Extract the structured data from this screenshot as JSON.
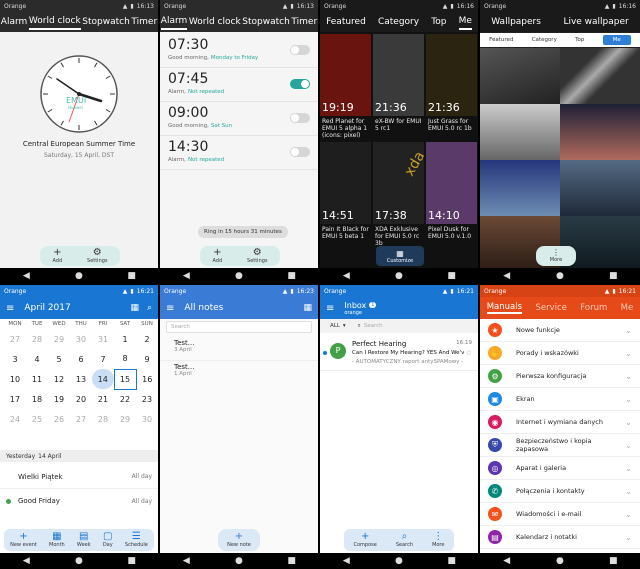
{
  "clock": {
    "status_carrier": "Orange",
    "status_time": "16:13",
    "tabs": [
      "Alarm",
      "World clock",
      "Stopwatch",
      "Timer"
    ],
    "clock_brand": "EMUI",
    "clock_sub": "Huawei",
    "zone_title": "Central European Summer Time",
    "zone_date": "Saturday, 15 April, DST",
    "add_label": "Add",
    "settings_label": "Settings"
  },
  "alarm": {
    "status_carrier": "Orange",
    "status_time": "16:13",
    "tabs": [
      "Alarm",
      "World clock",
      "Stopwatch",
      "Timer"
    ],
    "alarms": [
      {
        "time": "07:30",
        "label": "Good morning,",
        "repeat": "Monday to Friday",
        "on": false
      },
      {
        "time": "07:45",
        "label": "Alarm,",
        "repeat": "Not repeated",
        "on": true
      },
      {
        "time": "09:00",
        "label": "Good morning,",
        "repeat": "Sat Sun",
        "on": false
      },
      {
        "time": "14:30",
        "label": "Alarm,",
        "repeat": "Not repeated",
        "on": false
      }
    ],
    "ring_text": "Ring in 15 hours 31 minutes",
    "add_label": "Add",
    "settings_label": "Settings"
  },
  "themes": {
    "status_carrier": "Orange",
    "status_time": "16:16",
    "tabs": [
      "Featured",
      "Category",
      "Top",
      "Me"
    ],
    "items": [
      {
        "time": "19:19",
        "caption": "Red Planet for EMUI 5 alpha 1 (icons: pixel)",
        "color": "#6a1410"
      },
      {
        "time": "21:36",
        "caption": "eX-BW for EMUI 5 rc1",
        "color": "#3a3a3a"
      },
      {
        "time": "21:36",
        "caption": "Just Grass for EMUI 5.0 rc 1b",
        "color": "#2a2410"
      },
      {
        "time": "14:51",
        "caption": "Pain It Black for EMUI 5 beta 1",
        "color": "#1e1e1e"
      },
      {
        "time": "17:38",
        "caption": "XDA Exklusive for EMUI 5.0 rc 3b",
        "color": "#222222"
      },
      {
        "time": "14:10",
        "caption": "Pixel Dusk for EMUI 5.0 v.1.0",
        "color": "#5a3a68"
      }
    ],
    "customize_label": "Customize",
    "xda_text": "xda"
  },
  "wallpapers": {
    "status_carrier": "Orange",
    "status_time": "16:16",
    "tabs": [
      "Wallpapers",
      "Live wallpaper"
    ],
    "subtabs": [
      "Featured",
      "Category",
      "Top",
      "Me"
    ],
    "more_label": "More"
  },
  "calendar": {
    "status_carrier": "Orange",
    "status_time": "16:21",
    "month": "April 2017",
    "days": [
      "MON",
      "TUE",
      "WED",
      "THU",
      "FRI",
      "SAT",
      "SUN"
    ],
    "weeks": [
      [
        "27",
        "28",
        "29",
        "30",
        "31",
        "1",
        "2"
      ],
      [
        "3",
        "4",
        "5",
        "6",
        "7",
        "8",
        "9"
      ],
      [
        "10",
        "11",
        "12",
        "13",
        "14",
        "15",
        "16"
      ],
      [
        "17",
        "18",
        "19",
        "20",
        "21",
        "22",
        "23"
      ],
      [
        "24",
        "25",
        "26",
        "27",
        "28",
        "29",
        "30"
      ]
    ],
    "day_header": "Yesterday",
    "day_date": "14 April",
    "events": [
      {
        "title": "Wielki Piątek",
        "when": "All day"
      },
      {
        "title": "Good Friday",
        "when": "All day"
      }
    ],
    "bottom": [
      "New event",
      "Month",
      "Week",
      "Day",
      "Schedule"
    ]
  },
  "notes": {
    "status_carrier": "Orange",
    "status_time": "16:23",
    "title": "All notes",
    "search_placeholder": "Search",
    "notes": [
      {
        "title": "Test...",
        "date": "3 April"
      },
      {
        "title": "Test...",
        "date": "1 April"
      }
    ],
    "new_label": "New note"
  },
  "email": {
    "status_carrier": "Orange",
    "status_time": "16:21",
    "title": "Inbox",
    "badge": "1",
    "account": "orange",
    "filter": "ALL",
    "search_placeholder": "Search",
    "message": {
      "avatar": "P",
      "sender": "Perfect Hearing",
      "time": "16:19",
      "subject": "Can I Restore My Hearing? YES And We've...",
      "preview": "- AUTOMATYCZNY raport antySPAMowy -..."
    },
    "bottom": [
      "Compose",
      "Search",
      "More"
    ]
  },
  "manuals": {
    "status_carrier": "Orange",
    "status_time": "16:21",
    "tabs": [
      "Manuals",
      "Service",
      "Forum",
      "Me"
    ],
    "items": [
      {
        "label": "Nowe funkcje",
        "color": "#f4511e",
        "icon": "★"
      },
      {
        "label": "Porady i wskazówki",
        "color": "#f9a825",
        "icon": "✋"
      },
      {
        "label": "Pierwsza konfiguracja",
        "color": "#43a047",
        "icon": "⚙"
      },
      {
        "label": "Ekran",
        "color": "#1e88e5",
        "icon": "▣"
      },
      {
        "label": "Internet i wymiana danych",
        "color": "#d81b60",
        "icon": "◉"
      },
      {
        "label": "Bezpieczeństwo i kopia zapasowa",
        "color": "#3949ab",
        "icon": "⛨"
      },
      {
        "label": "Aparat i galeria",
        "color": "#5e35b1",
        "icon": "◎"
      },
      {
        "label": "Połączenia i kontakty",
        "color": "#00897b",
        "icon": "✆"
      },
      {
        "label": "Wiadomości i e-mail",
        "color": "#f4511e",
        "icon": "✉"
      },
      {
        "label": "Kalendarz i notatki",
        "color": "#8e24aa",
        "icon": "▤"
      }
    ]
  }
}
